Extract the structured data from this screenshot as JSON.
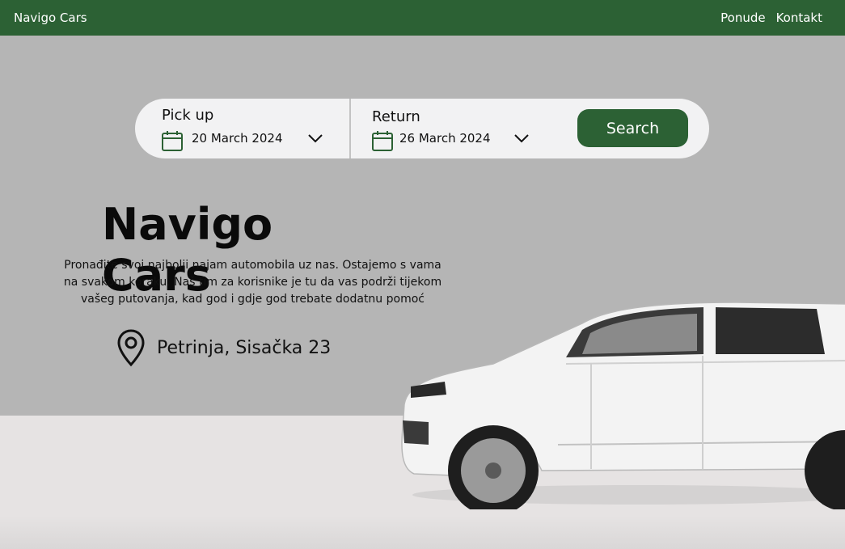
{
  "topbar": {
    "brand": "Navigo Cars",
    "nav": [
      "Ponude",
      "Kontakt"
    ]
  },
  "search": {
    "pickup": {
      "label": "Pick up",
      "date": "20 March 2024"
    },
    "return": {
      "label": "Return",
      "date": "26 March 2024"
    },
    "button": "Search"
  },
  "hero": {
    "title": "Navigo Cars",
    "description": [
      "Pronađite svoj najbolji najam automobila  uz nas. Ostajemo s vama",
      "na svakom koraku. Naš tim za korisnike je tu da vas podrži tijekom",
      "vašeg putovanja, kad god i gdje god trebate dodatnu pomoć"
    ],
    "location": "Petrinja, Sisačka 23"
  },
  "colors": {
    "brand_green": "#2c6134",
    "hero_gray": "#b5b5b5",
    "floor": "#e6e3e3",
    "search_bg": "#f2f2f3"
  },
  "icons": [
    "calendar-icon",
    "chevron-down-icon",
    "location-pin-icon"
  ]
}
